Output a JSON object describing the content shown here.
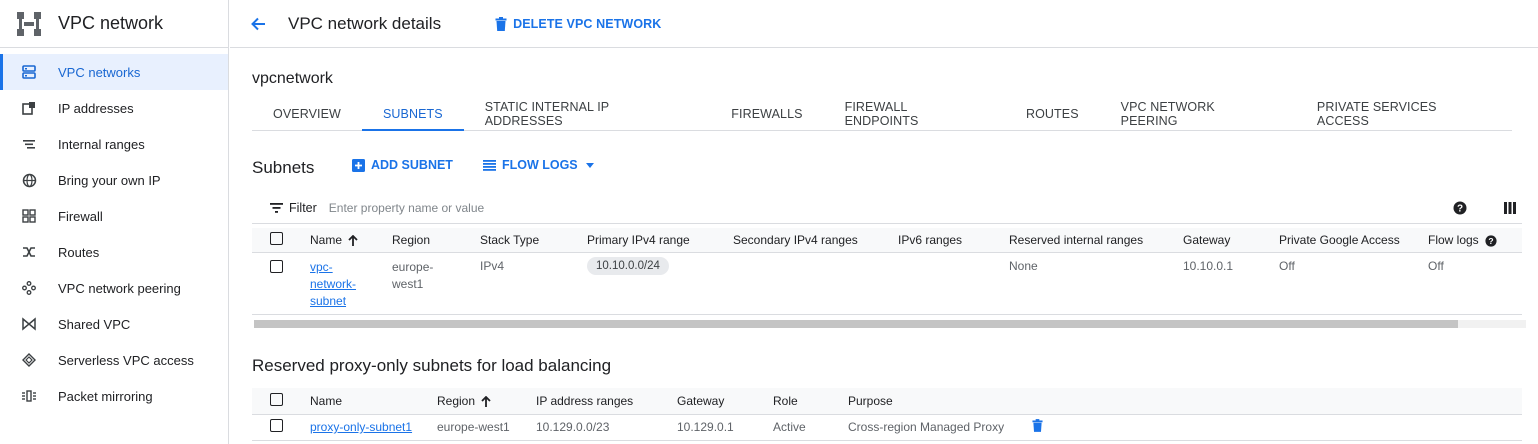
{
  "sidebar": {
    "title": "VPC network",
    "items": [
      {
        "label": "VPC networks",
        "icon": "vpc-networks-icon",
        "active": true
      },
      {
        "label": "IP addresses",
        "icon": "ip-addresses-icon",
        "active": false
      },
      {
        "label": "Internal ranges",
        "icon": "internal-ranges-icon",
        "active": false
      },
      {
        "label": "Bring your own IP",
        "icon": "globe-icon",
        "active": false
      },
      {
        "label": "Firewall",
        "icon": "firewall-icon",
        "active": false
      },
      {
        "label": "Routes",
        "icon": "routes-icon",
        "active": false
      },
      {
        "label": "VPC network peering",
        "icon": "peering-icon",
        "active": false
      },
      {
        "label": "Shared VPC",
        "icon": "shared-vpc-icon",
        "active": false
      },
      {
        "label": "Serverless VPC access",
        "icon": "serverless-icon",
        "active": false
      },
      {
        "label": "Packet mirroring",
        "icon": "packet-mirroring-icon",
        "active": false
      }
    ]
  },
  "header": {
    "title": "VPC network details",
    "delete_label": "DELETE VPC NETWORK"
  },
  "network": {
    "name": "vpcnetwork"
  },
  "tabs": [
    {
      "label": "OVERVIEW",
      "active": false
    },
    {
      "label": "SUBNETS",
      "active": true
    },
    {
      "label": "STATIC INTERNAL IP ADDRESSES",
      "active": false
    },
    {
      "label": "FIREWALLS",
      "active": false
    },
    {
      "label": "FIREWALL ENDPOINTS",
      "active": false
    },
    {
      "label": "ROUTES",
      "active": false
    },
    {
      "label": "VPC NETWORK PEERING",
      "active": false
    },
    {
      "label": "PRIVATE SERVICES ACCESS",
      "active": false
    }
  ],
  "subnets": {
    "title": "Subnets",
    "add_label": "ADD SUBNET",
    "flow_logs_label": "FLOW LOGS",
    "filter_label": "Filter",
    "filter_placeholder": "Enter property name or value",
    "columns": [
      "Name",
      "Region",
      "Stack Type",
      "Primary IPv4 range",
      "Secondary IPv4 ranges",
      "IPv6 ranges",
      "Reserved internal ranges",
      "Gateway",
      "Private Google Access",
      "Flow logs"
    ],
    "rows": [
      {
        "name_lines": [
          "vpc-",
          "network-",
          "subnet"
        ],
        "region_lines": [
          "europe-",
          "west1"
        ],
        "stack_type": "IPv4",
        "primary_range": "10.10.0.0/24",
        "secondary": "",
        "ipv6": "",
        "reserved": "None",
        "gateway": "10.10.0.1",
        "private_google_access": "Off",
        "flow_logs": "Off"
      }
    ]
  },
  "proxy": {
    "title": "Reserved proxy-only subnets for load balancing",
    "columns": [
      "Name",
      "Region",
      "IP address ranges",
      "Gateway",
      "Role",
      "Purpose"
    ],
    "rows": [
      {
        "name": "proxy-only-subnet1",
        "region": "europe-west1",
        "range": "10.129.0.0/23",
        "gateway": "10.129.0.1",
        "role": "Active",
        "purpose": "Cross-region Managed Proxy"
      }
    ]
  },
  "colors": {
    "accent": "#1a73e8",
    "active_bg": "#e8f0fe"
  }
}
